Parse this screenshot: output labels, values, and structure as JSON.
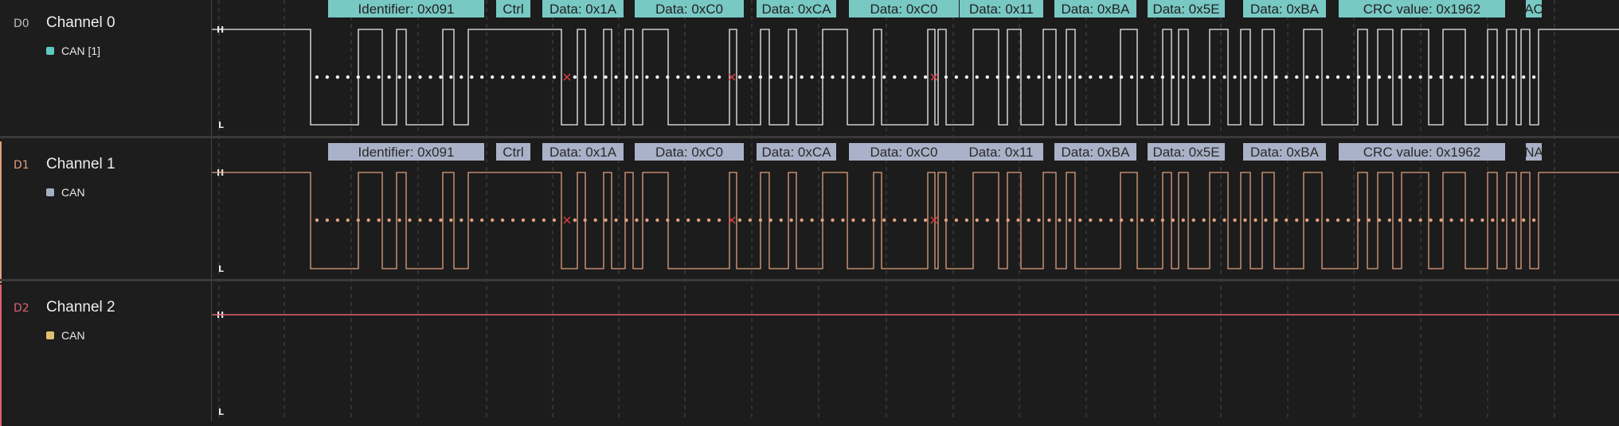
{
  "colors": {
    "background": "#1c1c1c",
    "grid": "#4a4a4a",
    "channel0": "#f0f0f0",
    "channel1": "#e0a07e",
    "channel2": "#e06070",
    "decode0_bg": "#78c8c4",
    "decode1_bg": "#a9b2c8",
    "error_marker": "#e04040"
  },
  "level_labels": {
    "high": "H",
    "low": "L"
  },
  "channels": [
    {
      "id": "D0",
      "name": "Channel 0",
      "decoder": {
        "label": "CAN [1]",
        "swatch": "#5fc8c2"
      },
      "color": "#f0f0f0",
      "frames": [
        "Identifier: 0x091",
        "Ctrl",
        "Data: 0x1A",
        "Data: 0xC0",
        "Data: 0xCA",
        "Data: 0xC0",
        "Data: 0x11",
        "Data: 0xBA",
        "Data: 0x5E",
        "Data: 0xBA",
        "CRC value: 0x1962",
        "AC"
      ]
    },
    {
      "id": "D1",
      "name": "Channel 1",
      "decoder": {
        "label": "CAN",
        "swatch": "#a6aec6"
      },
      "color": "#e0a07e",
      "frames": [
        "Identifier: 0x091",
        "Ctrl",
        "Data: 0x1A",
        "Data: 0xC0",
        "Data: 0xCA",
        "Data: 0xC0",
        "Data: 0x11",
        "Data: 0xBA",
        "Data: 0x5E",
        "Data: 0xBA",
        "CRC value: 0x1962",
        "NA"
      ]
    },
    {
      "id": "D2",
      "name": "Channel 2",
      "decoder": {
        "label": "CAN",
        "swatch": "#e0c070"
      },
      "color": "#e06070",
      "frames": []
    }
  ]
}
